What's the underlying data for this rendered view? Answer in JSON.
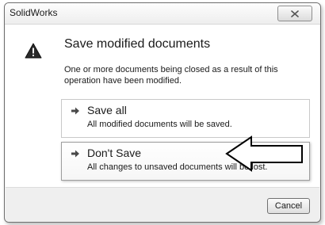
{
  "window": {
    "title": "SolidWorks",
    "close_icon": "close-x-icon"
  },
  "dialog": {
    "icon": "warning-triangle-icon",
    "heading": "Save modified documents",
    "description": "One or more documents being closed as a result of this operation have been modified.",
    "options": [
      {
        "icon": "green-arrow-icon",
        "title": "Save all",
        "subtitle": "All modified documents will be saved."
      },
      {
        "icon": "green-arrow-icon",
        "title": "Don't Save",
        "subtitle": "All changes to unsaved documents will be lost."
      }
    ],
    "cancel_label": "Cancel"
  },
  "colors": {
    "arrow_green": "#4a9a3a",
    "warning_fill": "#1f1f1f"
  }
}
